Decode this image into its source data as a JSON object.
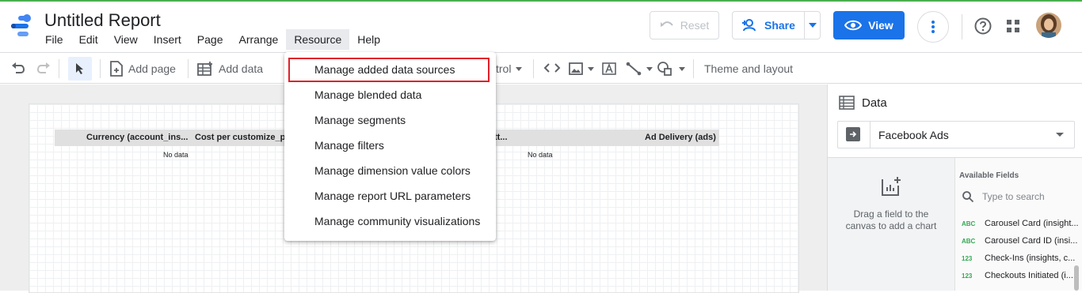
{
  "app": {
    "title": "Untitled Report",
    "menu": [
      "File",
      "Edit",
      "View",
      "Insert",
      "Page",
      "Arrange",
      "Resource",
      "Help"
    ],
    "active_menu": "Resource"
  },
  "header_actions": {
    "reset_label": "Reset",
    "share_label": "Share",
    "view_label": "View"
  },
  "toolbar": {
    "add_page_label": "Add page",
    "add_data_label": "Add data",
    "control_label": "trol",
    "theme_label": "Theme and layout"
  },
  "table": {
    "columns": [
      "Currency (account_ins...",
      "Cost per customize_pr...",
      "...",
      "Ad Delivery (ads)"
    ],
    "col3_fragment": "tt...",
    "no_data_label": "No data"
  },
  "resource_menu": {
    "items": [
      "Manage added data sources",
      "Manage blended data",
      "Manage segments",
      "Manage filters",
      "Manage dimension value colors",
      "Manage report URL parameters",
      "Manage community visualizations"
    ],
    "highlighted_index": 0
  },
  "data_panel": {
    "title": "Data",
    "data_source": "Facebook Ads",
    "drag_hint": "Drag a field to the canvas to add a chart",
    "available_fields_title": "Available Fields",
    "search_placeholder": "Type to search",
    "fields": [
      {
        "type": "ABC",
        "name": "Carousel Card (insight..."
      },
      {
        "type": "ABC",
        "name": "Carousel Card ID (insi..."
      },
      {
        "type": "123",
        "name": "Check-Ins (insights, c..."
      },
      {
        "type": "123",
        "name": "Checkouts Initiated (i..."
      }
    ]
  },
  "colors": {
    "accent": "#1a73e8",
    "highlight_border": "#e0202a",
    "dimension_type": "#34a853"
  }
}
